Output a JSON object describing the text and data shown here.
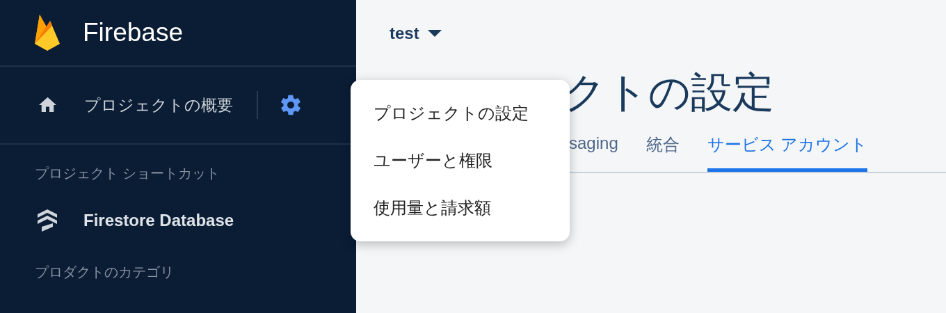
{
  "sidebar": {
    "brand": "Firebase",
    "overview": {
      "label": "プロジェクトの概要"
    },
    "sections": [
      {
        "kind": "header",
        "label": "プロジェクト ショートカット"
      },
      {
        "kind": "item",
        "label": "Firestore Database"
      },
      {
        "kind": "header",
        "label": "プロダクトのカテゴリ"
      }
    ]
  },
  "project": {
    "name": "test"
  },
  "page": {
    "title": "クトの設定"
  },
  "tabs": [
    {
      "label": "saging",
      "selected": false
    },
    {
      "label": "統合",
      "selected": false
    },
    {
      "label": "サービス アカウント",
      "selected": true
    }
  ],
  "menu": {
    "items": [
      "プロジェクトの設定",
      "ユーザーと権限",
      "使用量と請求額"
    ]
  }
}
